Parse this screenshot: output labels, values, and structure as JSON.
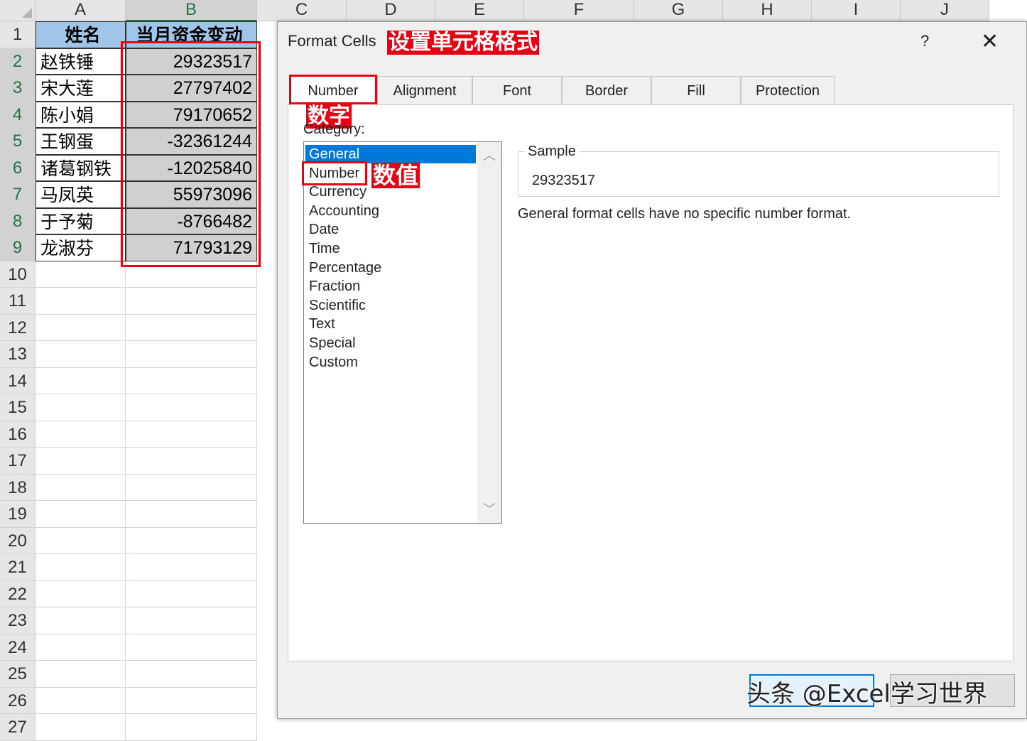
{
  "sheet": {
    "columns": [
      "A",
      "B",
      "C",
      "D",
      "E",
      "F",
      "G",
      "H",
      "I",
      "J"
    ],
    "rows": [
      "1",
      "2",
      "3",
      "4",
      "5",
      "6",
      "7",
      "8",
      "9",
      "10",
      "11",
      "12",
      "13",
      "14",
      "15",
      "16",
      "17",
      "18",
      "19",
      "20",
      "21",
      "22",
      "23",
      "24",
      "25",
      "26",
      "27"
    ],
    "header": {
      "name": "姓名",
      "amount": "当月资金变动"
    },
    "data": [
      {
        "name": "赵铁锤",
        "amount": "29323517"
      },
      {
        "name": "宋大莲",
        "amount": "27797402"
      },
      {
        "name": "陈小娟",
        "amount": "79170652"
      },
      {
        "name": "王钢蛋",
        "amount": "-32361244"
      },
      {
        "name": "诸葛钢铁",
        "amount": "-12025840"
      },
      {
        "name": "马凤英",
        "amount": "55973096"
      },
      {
        "name": "于予菊",
        "amount": "-8766482"
      },
      {
        "name": "龙淑芬",
        "amount": "71793129"
      }
    ]
  },
  "dialog": {
    "title": "Format Cells",
    "help": "?",
    "close": "✕",
    "tabs": [
      "Number",
      "Alignment",
      "Font",
      "Border",
      "Fill",
      "Protection"
    ],
    "category_label": "Category:",
    "categories": [
      "General",
      "Number",
      "Currency",
      "Accounting",
      "Date",
      "Time",
      "Percentage",
      "Fraction",
      "Scientific",
      "Text",
      "Special",
      "Custom"
    ],
    "selected_category": "General",
    "sample_label": "Sample",
    "sample_value": "29323517",
    "description": "General format cells have no specific number format."
  },
  "annotations": {
    "title_label": "设置单元格格式",
    "tab_label": "数字",
    "category_label": "数值",
    "accent": "#e60012"
  },
  "watermark": "头条 @Excel学习世界",
  "colors": {
    "header_fill": "#9fc5e8",
    "selection": "#0078d7",
    "excel_green": "#217346"
  }
}
